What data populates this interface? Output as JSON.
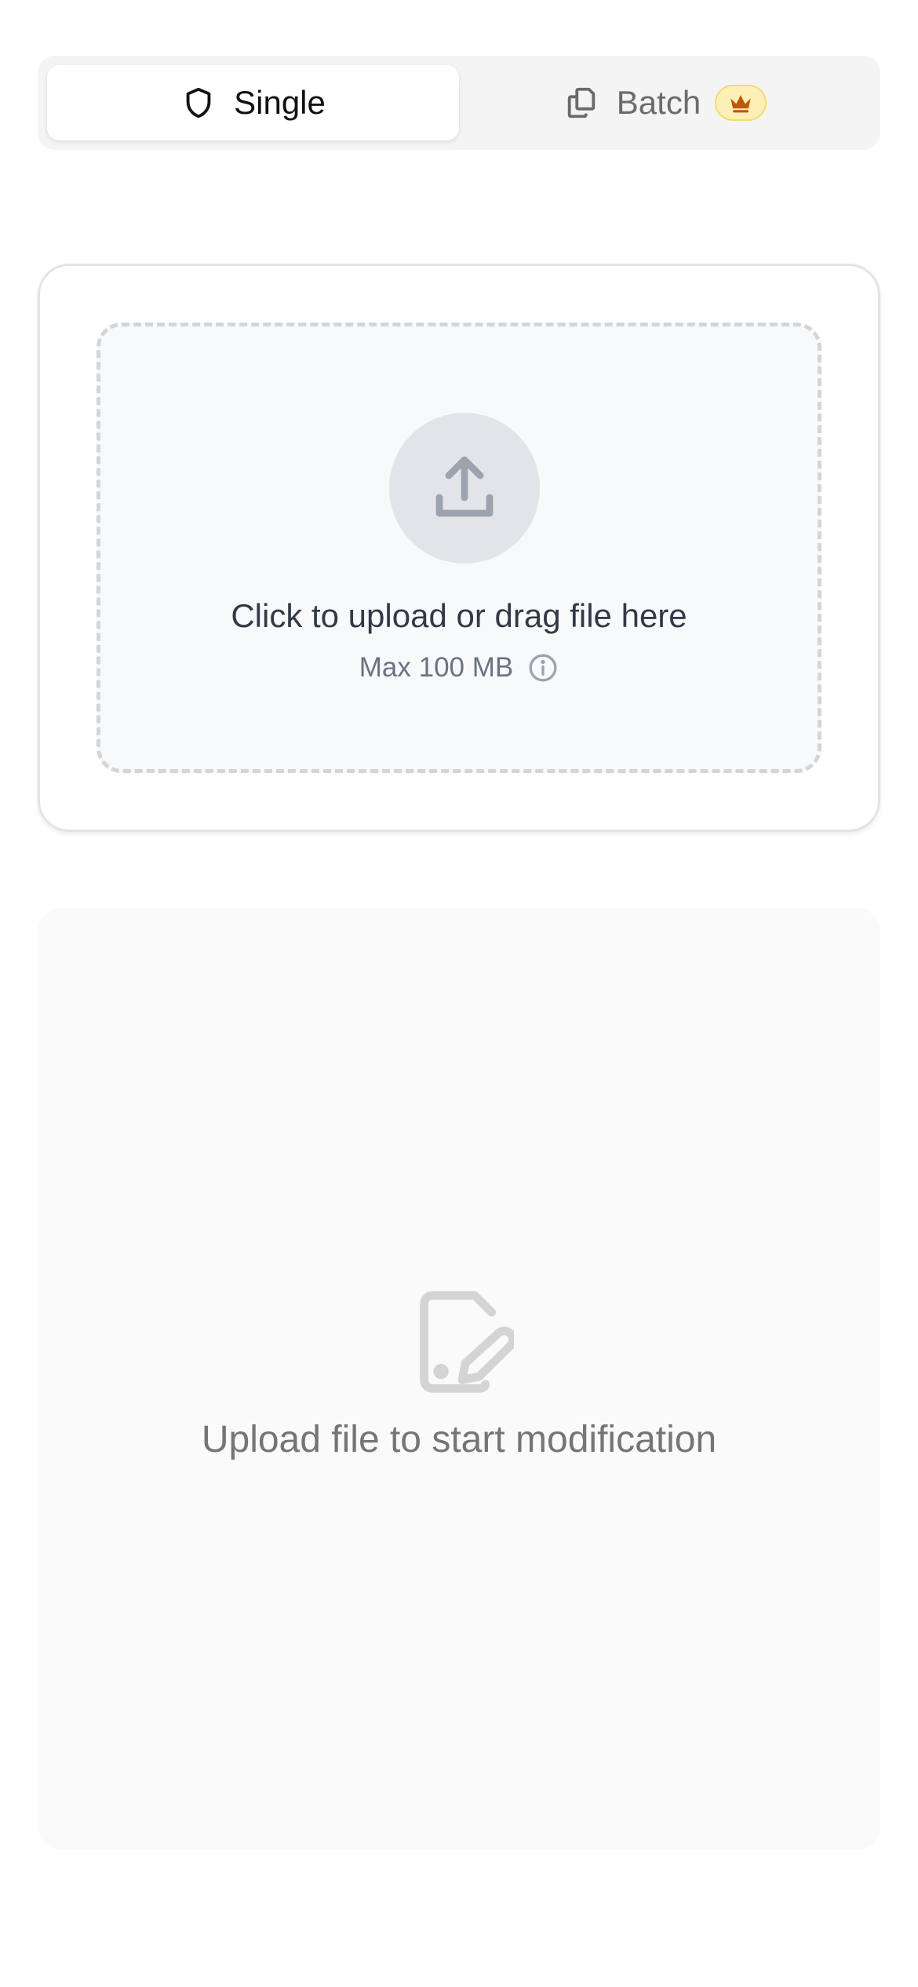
{
  "tabs": {
    "single_label": "Single",
    "batch_label": "Batch",
    "active": "single",
    "icons": {
      "single": "shield-icon",
      "batch": "copy-icon",
      "premium": "crown-icon"
    }
  },
  "upload": {
    "title": "Click to upload or drag file here",
    "limit": "Max 100 MB",
    "icons": {
      "upload": "upload-icon",
      "info": "info-icon"
    }
  },
  "empty_state": {
    "message": "Upload file to start modification",
    "icon": "file-edit-icon"
  },
  "colors": {
    "crown": "#c2570c",
    "crown_badge_bg": "#fdf0b6",
    "upload_icon": "#9ca3af",
    "empty_icon": "#d4d4d4"
  }
}
